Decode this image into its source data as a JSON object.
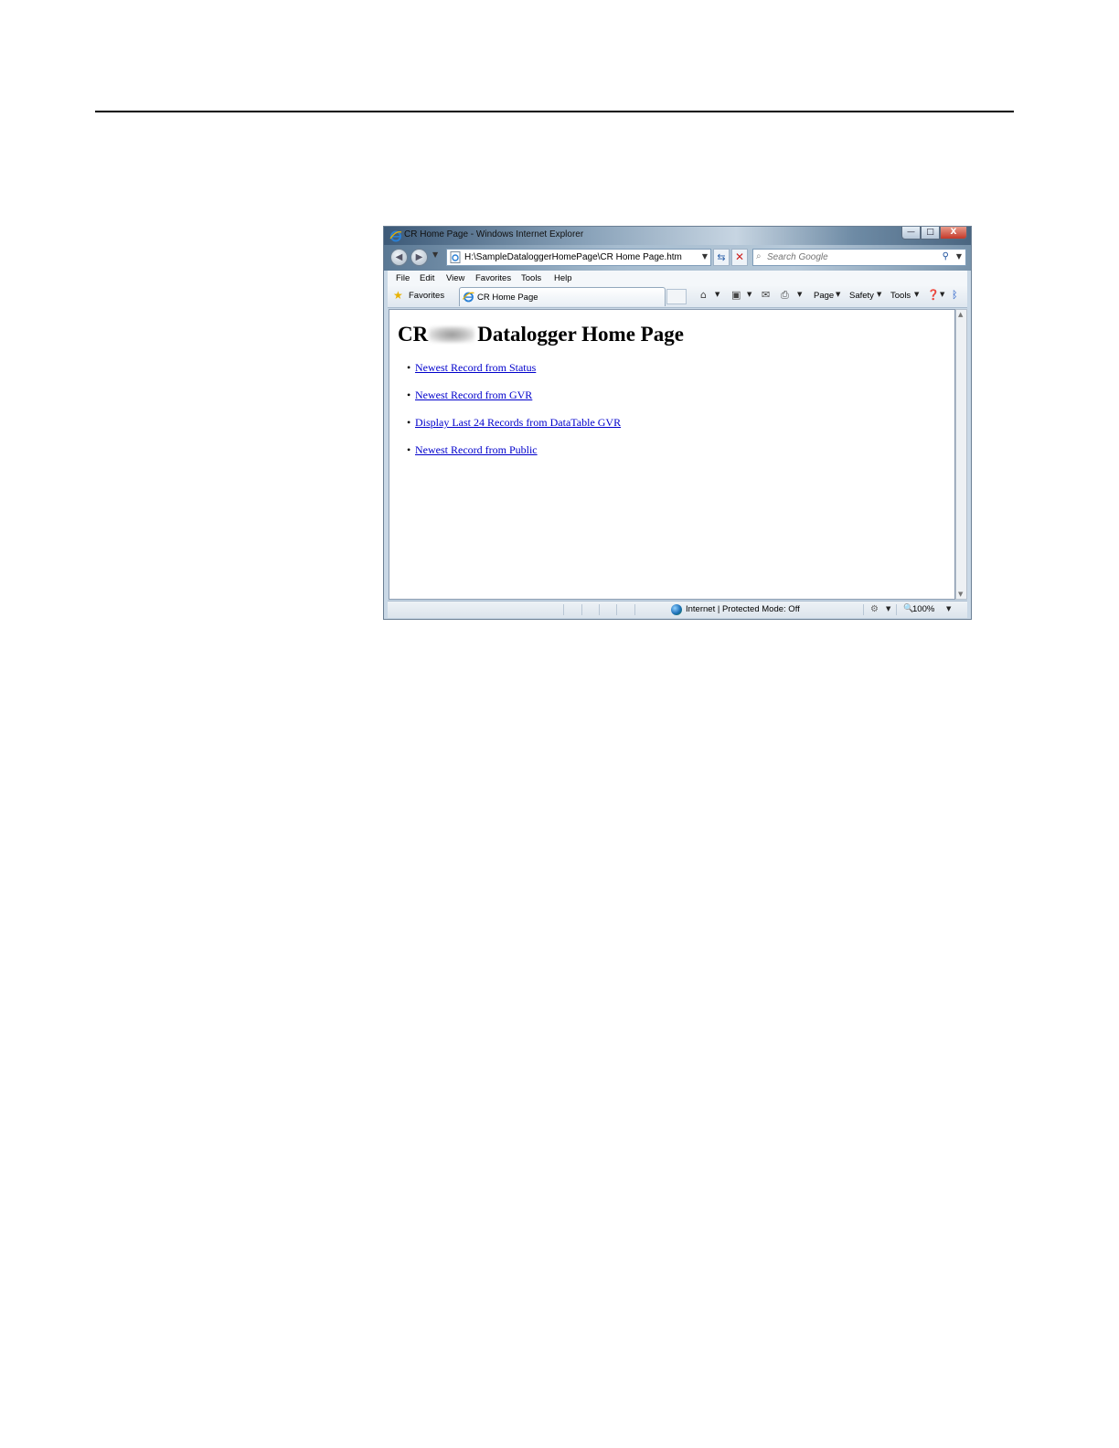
{
  "window": {
    "title": "CR      Home Page - Windows Internet Explorer",
    "controls": {
      "minimize": "—",
      "maximize": "□",
      "close": "X"
    }
  },
  "navigation": {
    "address": "H:\\SampleDataloggerHomePage\\CR        Home Page.htm",
    "search_placeholder": "Search Google"
  },
  "menu": {
    "items": [
      "File",
      "Edit",
      "View",
      "Favorites",
      "Tools",
      "Help"
    ]
  },
  "command_bar": {
    "favorites_label": "Favorites",
    "tab_title": "CR       Home Page",
    "page_label": "Page",
    "safety_label": "Safety",
    "tools_label": "Tools"
  },
  "page": {
    "heading_prefix": "CR",
    "heading_suffix": "Datalogger Home Page",
    "links": [
      "Newest Record from Status",
      "Newest Record from GVR",
      "Display Last 24 Records from DataTable GVR",
      "Newest Record from Public"
    ]
  },
  "status_bar": {
    "zone_text": "Internet | Protected Mode: Off",
    "zoom": "100%"
  }
}
